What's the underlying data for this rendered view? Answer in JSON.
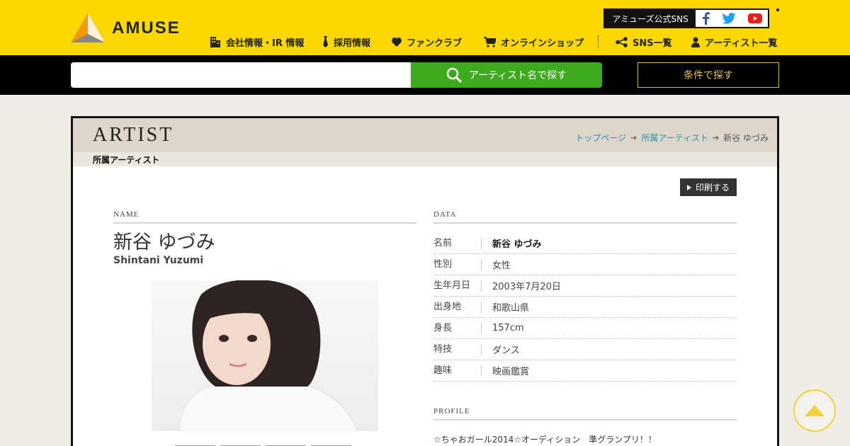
{
  "header": {
    "logo_text": "AMUSE",
    "sns_label": "アミューズ公式SNS",
    "sns_icons": [
      "facebook-icon",
      "twitter-icon",
      "youtube-icon"
    ],
    "nav": [
      {
        "label": "会社情報・IR 情報",
        "icon": "building-icon"
      },
      {
        "label": "採用情報",
        "icon": "tie-icon"
      },
      {
        "label": "ファンクラブ",
        "icon": "heart-icon"
      },
      {
        "label": "オンラインショップ",
        "icon": "cart-icon"
      },
      {
        "label": "SNS一覧",
        "icon": "share-icon"
      },
      {
        "label": "アーティスト一覧",
        "icon": "person-icon"
      }
    ]
  },
  "search": {
    "placeholder": "",
    "button_label": "アーティスト名で探す",
    "condition_button": "条件で探す"
  },
  "page": {
    "title": "ARTIST",
    "subtitle": "所属アーティスト",
    "breadcrumb": [
      "トップページ",
      "所属アーティスト",
      "新谷 ゆづみ"
    ],
    "print_label": "印刷する"
  },
  "artist": {
    "name_section": "NAME",
    "name_jp": "新谷 ゆづみ",
    "name_en": "Shintani Yuzumi",
    "data_section": "DATA",
    "data": [
      {
        "key": "名前",
        "value": "新谷 ゆづみ"
      },
      {
        "key": "性別",
        "value": "女性"
      },
      {
        "key": "生年月日",
        "value": "2003年7月20日"
      },
      {
        "key": "出身地",
        "value": "和歌山県"
      },
      {
        "key": "身長",
        "value": "157cm"
      },
      {
        "key": "特技",
        "value": "ダンス"
      },
      {
        "key": "趣味",
        "value": "映画鑑賞"
      }
    ],
    "profile_section": "PROFILE",
    "profile_text": "☆ちゃおガール2014☆オーディション　準グランプリ！！"
  },
  "colors": {
    "header_yellow": "#fcd800",
    "search_green": "#3daa1e",
    "link_blue": "#2a8fb0"
  }
}
